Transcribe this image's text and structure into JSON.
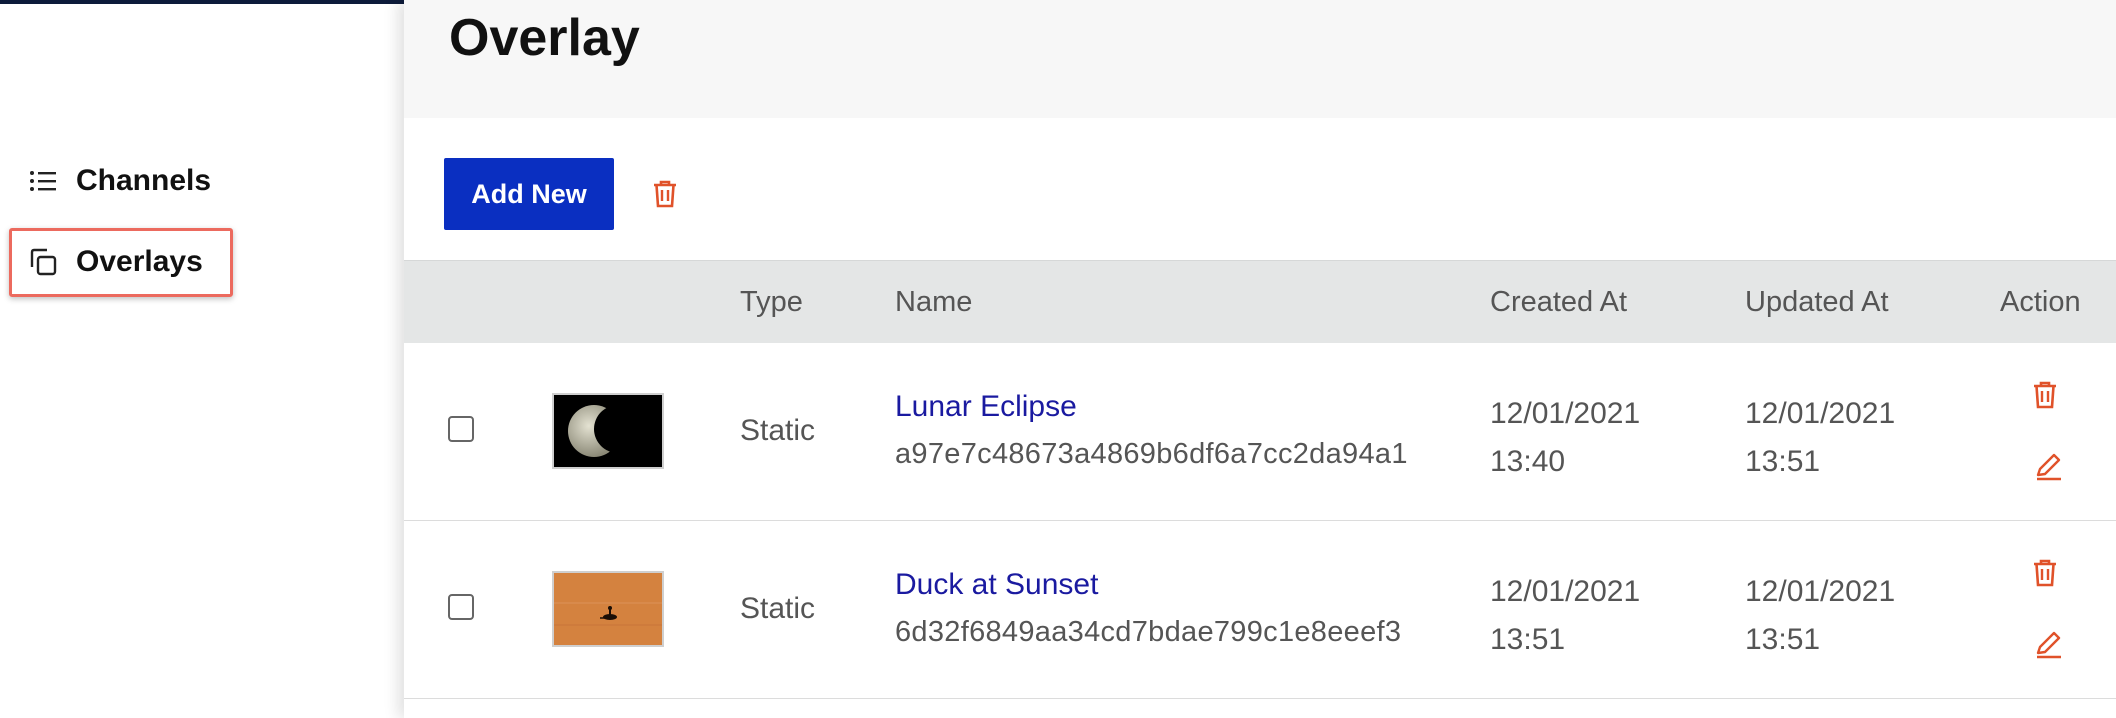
{
  "sidebar": {
    "items": [
      {
        "label": "Channels",
        "icon": "list-icon"
      },
      {
        "label": "Overlays",
        "icon": "copy-icon"
      }
    ]
  },
  "page": {
    "title": "Overlay"
  },
  "toolbar": {
    "add_label": "Add New",
    "delete_icon": "trash-icon"
  },
  "table": {
    "headers": {
      "type": "Type",
      "name": "Name",
      "created": "Created At",
      "updated": "Updated At",
      "action": "Action"
    },
    "rows": [
      {
        "type": "Static",
        "name": "Lunar Eclipse",
        "id": "a97e7c48673a4869b6df6a7cc2da94a1",
        "created_date": "12/01/2021",
        "created_time": "13:40",
        "updated_date": "12/01/2021",
        "updated_time": "13:51"
      },
      {
        "type": "Static",
        "name": "Duck at Sunset",
        "id": "6d32f6849aa34cd7bdae799c1e8eeef3",
        "created_date": "12/01/2021",
        "created_time": "13:51",
        "updated_date": "12/01/2021",
        "updated_time": "13:51"
      }
    ]
  },
  "colors": {
    "primary": "#0a2fc1",
    "danger": "#e0522a",
    "link": "#1a1aa0",
    "highlight": "#ec6a5e"
  }
}
